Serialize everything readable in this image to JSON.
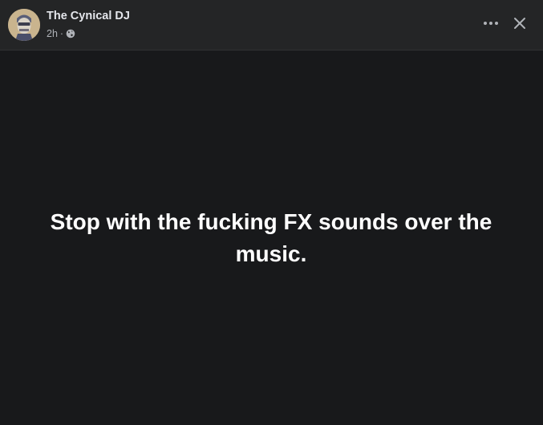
{
  "post": {
    "author_name": "The Cynical DJ",
    "timestamp": "2h",
    "separator": "·",
    "audience_icon": "globe-icon",
    "text": "Stop with the fucking FX sounds over the music."
  },
  "header": {
    "more_icon": "more-horizontal-icon",
    "close_icon": "close-icon"
  },
  "colors": {
    "background": "#18191b",
    "header_background": "#242526",
    "primary_text": "#e4e6eb",
    "secondary_text": "#b0b3b8",
    "post_text": "#ffffff"
  }
}
